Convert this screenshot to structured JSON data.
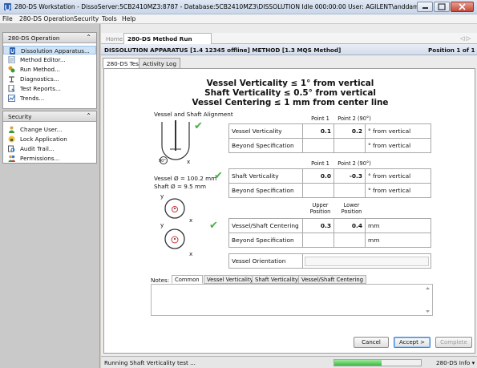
{
  "window": {
    "title": "280-DS Workstation - DissoServer:5CB2410MZ3:8787 - Database:5CB2410MZ3\\DISSOLUTION   Idle 000:00:00  User: AGILENT\\anddamon"
  },
  "menu": {
    "items": [
      "File",
      "280-DS Operation",
      "Security",
      "Tools",
      "Help"
    ]
  },
  "sidebar": {
    "operation": {
      "title": "280-DS Operation",
      "items": [
        {
          "label": "Dissolution Apparatus...",
          "icon": "dissolution-apparatus-icon"
        },
        {
          "label": "Method Editor...",
          "icon": "method-editor-icon"
        },
        {
          "label": "Run Method...",
          "icon": "run-method-icon"
        },
        {
          "label": "Diagnostics...",
          "icon": "diagnostics-icon"
        },
        {
          "label": "Test Reports...",
          "icon": "test-reports-icon"
        },
        {
          "label": "Trends...",
          "icon": "trends-icon"
        }
      ]
    },
    "security": {
      "title": "Security",
      "items": [
        {
          "label": "Change User...",
          "icon": "user-icon"
        },
        {
          "label": "Lock Application",
          "icon": "lock-icon"
        },
        {
          "label": "Audit Trail...",
          "icon": "audit-trail-icon"
        },
        {
          "label": "Permissions...",
          "icon": "permissions-icon"
        }
      ]
    }
  },
  "tabs": {
    "home": "Home",
    "current": "280-DS Method Run",
    "nav": "◁ ▷"
  },
  "infobar": {
    "text": "DISSOLUTION APPARATUS [1.4 12345 offline] METHOD [1.3 MQS Method]",
    "position": "Position 1 of 1"
  },
  "subtabs": [
    "280-DS Test",
    "Activity Log"
  ],
  "headings": [
    "Vessel Verticality ≤ 1° from vertical",
    "Shaft Verticality ≤ 0.5° from vertical",
    "Vessel Centering ≤ 1 mm from center line"
  ],
  "diagram": {
    "title": "Vessel and Shaft Alignment",
    "angle_label": "90°",
    "axis_x": "x",
    "axis_y": "y",
    "vessel_diameter": "Vessel Ø = 100.2 mm",
    "shaft_diameter": "Shaft Ø  = 9.5 mm"
  },
  "vessel_verticality": {
    "col1": "Point 1",
    "col2": "Point 2 (90°)",
    "row_label": "Vessel Verticality",
    "v1": "0.1",
    "v2": "0.2",
    "unit": "° from vertical",
    "beyond_label": "Beyond Specification",
    "beyond_unit": "° from vertical"
  },
  "shaft_verticality": {
    "col1": "Point 1",
    "col2": "Point 2 (90°)",
    "row_label": "Shaft Verticality",
    "v1": "0.0",
    "v2": "-0.3",
    "unit": "° from vertical",
    "beyond_label": "Beyond Specification",
    "beyond_unit": "° from vertical"
  },
  "centering": {
    "col1_a": "Upper",
    "col1_b": "Position",
    "col2_a": "Lower",
    "col2_b": "Position",
    "row_label": "Vessel/Shaft Centering",
    "v1": "0.3",
    "v2": "0.4",
    "unit": "mm",
    "beyond_label": "Beyond Specification",
    "beyond_unit": "mm"
  },
  "orientation": {
    "label": "Vessel Orientation",
    "value": ""
  },
  "notes": {
    "label": "Notes:",
    "tabs": [
      "Common",
      "Vessel Verticality",
      "Shaft Verticality",
      "Vessel/Shaft Centering"
    ],
    "text": ""
  },
  "buttons": {
    "cancel": "Cancel",
    "accept": "Accept >",
    "complete": "Complete"
  },
  "status": {
    "text": "Running Shaft Verticality test ...",
    "progress": 0.55,
    "info": "280-DS Info ▾"
  },
  "colors": {
    "check": "#44b044",
    "accent": "#2a6ebb",
    "progress": "#4cc64c"
  }
}
